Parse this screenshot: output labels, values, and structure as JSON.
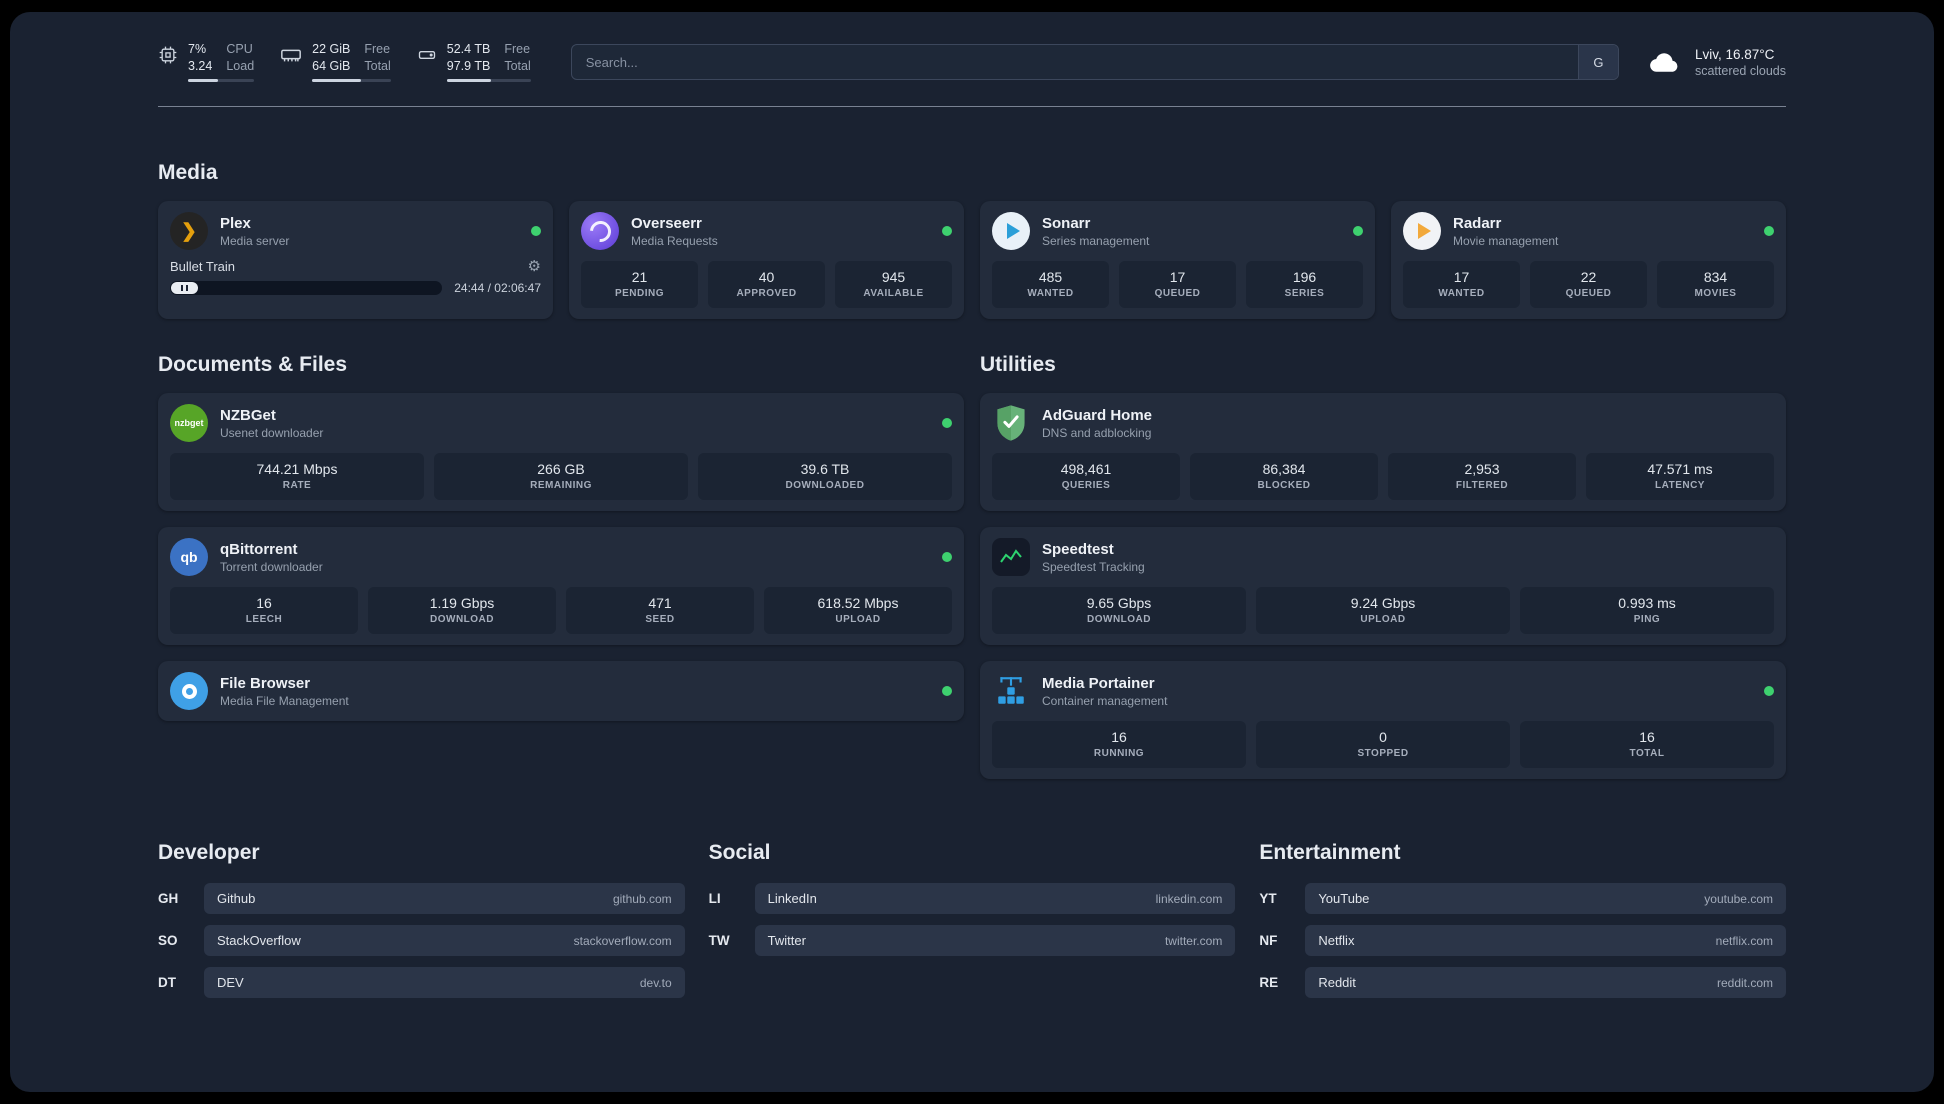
{
  "colors": {
    "background": "#1a2231",
    "status_online": "#3ed16f",
    "plex_accent": "#e5a00d",
    "adguard_green": "#67b279",
    "portainer_blue": "#2f9ee3"
  },
  "topbar": {
    "cpu": {
      "value_top": "7%",
      "value_bottom": "3.24",
      "label_top": "CPU",
      "label_bottom": "Load"
    },
    "memory": {
      "value_top": "22 GiB",
      "value_bottom": "64 GiB",
      "label_top": "Free",
      "label_bottom": "Total"
    },
    "disk": {
      "value_top": "52.4 TB",
      "value_bottom": "97.9 TB",
      "label_top": "Free",
      "label_bottom": "Total"
    },
    "search": {
      "placeholder": "Search...",
      "provider": "G"
    },
    "weather": {
      "location": "Lviv, 16.87°C",
      "condition": "scattered clouds"
    }
  },
  "sections": {
    "media": {
      "title": "Media"
    },
    "documents": {
      "title": "Documents & Files"
    },
    "utilities": {
      "title": "Utilities"
    }
  },
  "services": {
    "plex": {
      "name": "Plex",
      "subtitle": "Media server",
      "now_playing": "Bullet Train",
      "time": "24:44 / 02:06:47"
    },
    "overseerr": {
      "name": "Overseerr",
      "subtitle": "Media Requests",
      "stats": [
        {
          "value": "21",
          "label": "PENDING"
        },
        {
          "value": "40",
          "label": "APPROVED"
        },
        {
          "value": "945",
          "label": "AVAILABLE"
        }
      ]
    },
    "sonarr": {
      "name": "Sonarr",
      "subtitle": "Series management",
      "stats": [
        {
          "value": "485",
          "label": "WANTED"
        },
        {
          "value": "17",
          "label": "QUEUED"
        },
        {
          "value": "196",
          "label": "SERIES"
        }
      ]
    },
    "radarr": {
      "name": "Radarr",
      "subtitle": "Movie management",
      "stats": [
        {
          "value": "17",
          "label": "WANTED"
        },
        {
          "value": "22",
          "label": "QUEUED"
        },
        {
          "value": "834",
          "label": "MOVIES"
        }
      ]
    },
    "nzbget": {
      "name": "NZBGet",
      "subtitle": "Usenet downloader",
      "icon_text": "nzbget",
      "stats": [
        {
          "value": "744.21 Mbps",
          "label": "RATE"
        },
        {
          "value": "266 GB",
          "label": "REMAINING"
        },
        {
          "value": "39.6 TB",
          "label": "DOWNLOADED"
        }
      ]
    },
    "qbittorrent": {
      "name": "qBittorrent",
      "subtitle": "Torrent downloader",
      "icon_text": "qb",
      "stats": [
        {
          "value": "16",
          "label": "LEECH"
        },
        {
          "value": "1.19 Gbps",
          "label": "DOWNLOAD"
        },
        {
          "value": "471",
          "label": "SEED"
        },
        {
          "value": "618.52 Mbps",
          "label": "UPLOAD"
        }
      ]
    },
    "filebrowser": {
      "name": "File Browser",
      "subtitle": "Media File Management"
    },
    "adguard": {
      "name": "AdGuard Home",
      "subtitle": "DNS and adblocking",
      "stats": [
        {
          "value": "498,461",
          "label": "QUERIES"
        },
        {
          "value": "86,384",
          "label": "BLOCKED"
        },
        {
          "value": "2,953",
          "label": "FILTERED"
        },
        {
          "value": "47.571 ms",
          "label": "LATENCY"
        }
      ]
    },
    "speedtest": {
      "name": "Speedtest",
      "subtitle": "Speedtest Tracking",
      "stats": [
        {
          "value": "9.65 Gbps",
          "label": "DOWNLOAD"
        },
        {
          "value": "9.24 Gbps",
          "label": "UPLOAD"
        },
        {
          "value": "0.993 ms",
          "label": "PING"
        }
      ]
    },
    "portainer": {
      "name": "Media Portainer",
      "subtitle": "Container management",
      "stats": [
        {
          "value": "16",
          "label": "RUNNING"
        },
        {
          "value": "0",
          "label": "STOPPED"
        },
        {
          "value": "16",
          "label": "TOTAL"
        }
      ]
    }
  },
  "bookmarks": {
    "developer": {
      "title": "Developer",
      "links": [
        {
          "abbr": "GH",
          "name": "Github",
          "domain": "github.com"
        },
        {
          "abbr": "SO",
          "name": "StackOverflow",
          "domain": "stackoverflow.com"
        },
        {
          "abbr": "DT",
          "name": "DEV",
          "domain": "dev.to"
        }
      ]
    },
    "social": {
      "title": "Social",
      "links": [
        {
          "abbr": "LI",
          "name": "LinkedIn",
          "domain": "linkedin.com"
        },
        {
          "abbr": "TW",
          "name": "Twitter",
          "domain": "twitter.com"
        }
      ]
    },
    "entertainment": {
      "title": "Entertainment",
      "links": [
        {
          "abbr": "YT",
          "name": "YouTube",
          "domain": "youtube.com"
        },
        {
          "abbr": "NF",
          "name": "Netflix",
          "domain": "netflix.com"
        },
        {
          "abbr": "RE",
          "name": "Reddit",
          "domain": "reddit.com"
        }
      ]
    }
  }
}
